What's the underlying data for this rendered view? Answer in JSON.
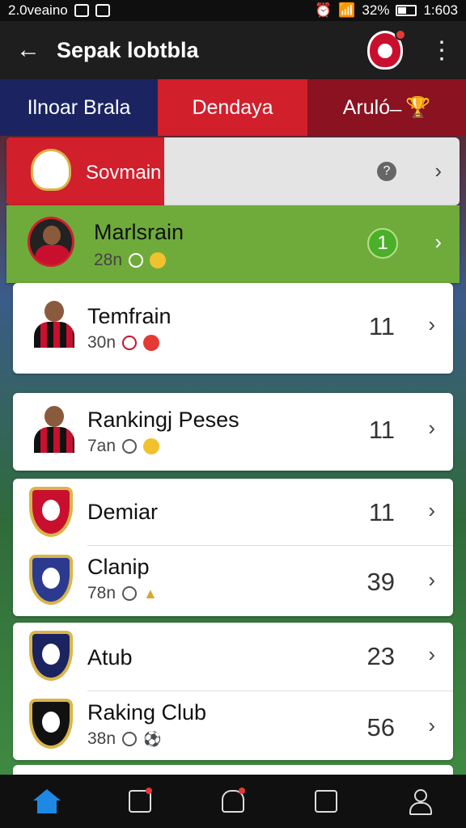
{
  "status_bar": {
    "time_left": "2.0veaino",
    "battery": "32%",
    "time_right": "1:603"
  },
  "app_bar": {
    "title": "Sepak lobtbla"
  },
  "tabs": [
    {
      "label": "Ilnoar Brala"
    },
    {
      "label": "Dendaya"
    },
    {
      "label": "Aruló ̶"
    }
  ],
  "header_card": {
    "label": "Sovmain"
  },
  "players": [
    {
      "name": "Marlsrain",
      "meta": "28n",
      "count": "1"
    },
    {
      "name": "Temfrain",
      "meta": "30n",
      "count": "11"
    },
    {
      "name": "Rankingj Peses",
      "meta": "7an",
      "count": "11"
    }
  ],
  "clubs": [
    {
      "name": "Demiar",
      "meta": "",
      "count": "11"
    },
    {
      "name": "Clanip",
      "meta": "78n",
      "count": "39"
    },
    {
      "name": "Atub",
      "meta": "",
      "count": "23"
    },
    {
      "name": "Raking Club",
      "meta": "38n",
      "count": "56"
    }
  ],
  "colors": {
    "header_red": "#d11f2c",
    "highlight_green": "#6fab3b",
    "tab_navy": "#1b2460",
    "tab_maroon": "#8b1220"
  }
}
